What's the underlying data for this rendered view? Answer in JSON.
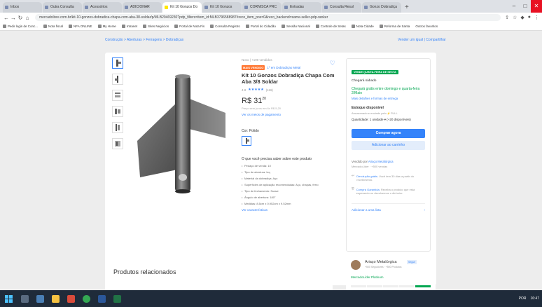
{
  "browser": {
    "tabs": [
      "Inbox",
      "Outra Consulta",
      "Acessórios",
      "ADICIONAR",
      "Kit 10 Gonzos Do",
      "Kit 10 Gonzos",
      "CORNISCA PRC",
      "Entradas",
      "Consulta Resul",
      "Gonzo Dobradiça"
    ],
    "new_tab": "+",
    "url": "mercadolivre.com.br/kit-10-gonzos-dobradica-chapa-com-aba-38-soldar/p/MLB29469230?pdp_filters=item_id:MLB3796588987#reco_item_pos=0&reco_backend=same-seller-pdp-ranker",
    "bookmarks": [
      "Pedir login de Conc...",
      "Nota fiscal",
      "NFA ONLINE",
      "My Home",
      "Intranet",
      "Sites Negócios",
      "Portal de Nota Fis",
      "Consulta Registro",
      "Portal do Cidadão",
      "Sessão Nacional",
      "Controle de Setas",
      "Nota Cidade",
      "Reforma de Santa"
    ],
    "all_bookmarks": "Outros favoritos"
  },
  "page": {
    "breadcrumb": "Construção > Aberturas > Ferragens > Dobradiças",
    "sell_link": "Vender um igual | Compartilhar"
  },
  "product": {
    "condition": "Novo | +100 vendidos",
    "badge": "MAIS VENDIDO",
    "badge_note": "1º em Dobradiças Metal",
    "title": "Kit 10 Gonzos Dobradiça Chapa Com Aba 3/8 Soldar",
    "rating_value": "4.8",
    "rating_count": "(116)",
    "price": "R$ 31",
    "price_cents": "20",
    "installments": "Preço sem juros em 6x R$ 5,20",
    "payment_link": "Ver os meios de pagamento",
    "color_label": "Cor: Polido",
    "features_title": "O que você precisa saber sobre este produto",
    "features": [
      "Pedaço de venda: 10",
      "Tipo de abertura: Izq",
      "Material da dobradiça: Aço",
      "Superfícies de aplicação recomendadas: Aço, chapas, ferro",
      "Tipo de fechamento: Suave",
      "Ângulo de abertura: 180°",
      "Medidas: 8.5cm x 0.952cm x 9.52mm"
    ],
    "more_features": "Ver características"
  },
  "buybox": {
    "badge": "VENDE QUINTA-FEIRA DE SEXTA",
    "arrives": "Chegará sábado",
    "free_shipping": "Chegará grátis entre domingo e quarta-feira 2/Maio",
    "more_shipping": "Mais detalhes e formas de entrega",
    "stock_title": "Estoque disponível",
    "stock_sub": "Armazenado e enviado pelo ⚡FULL",
    "quantity": "Quantidade: 1 unidade ▾ (+20 disponíveis)",
    "buy_now": "Comprar agora",
    "add_cart": "Adicionar ao carrinho",
    "seller": "Vendido por",
    "seller_name": "Ariaço Metalúrgica",
    "seller_sales": "MercadoLíder · +500 vendas",
    "return_title": "Devolução grátis.",
    "return_text": "Você tem 30 dias a partir do recebimento.",
    "protected_title": "Compra Garantida.",
    "protected_text": "Receba o produto que está esperando ou devolvemos o dinheiro.",
    "add_favorites": "Adicionar a uma lista"
  },
  "related": {
    "title": "Produtos relacionados"
  },
  "seller_card": {
    "name": "Ariaço Metalúrgica",
    "badge": "Seguir",
    "sub": "+500 Seguidores · +500 Produtos",
    "leader": "MercadoLíder Platinum"
  },
  "taskbar": {
    "time": "16:47",
    "lang": "POR"
  },
  "colors": {
    "brand_yellow": "#ffe600",
    "primary_blue": "#3483fa",
    "success_green": "#00a650",
    "badge_orange": "#ff7733"
  }
}
